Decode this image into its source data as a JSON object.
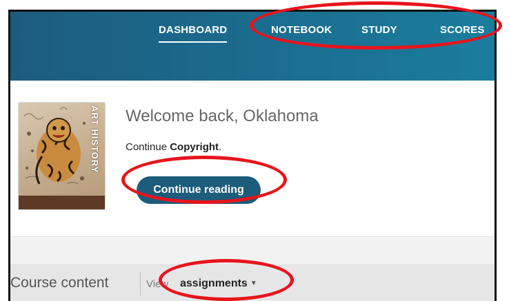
{
  "nav": {
    "items": [
      {
        "label": "DASHBOARD",
        "active": true
      },
      {
        "label": "NOTEBOOK",
        "active": false
      },
      {
        "label": "STUDY",
        "active": false
      },
      {
        "label": "SCORES",
        "active": false
      }
    ]
  },
  "book": {
    "cover_title": "ART HISTORY"
  },
  "welcome": {
    "heading": "Welcome back, Oklahoma",
    "continue_prefix": "Continue ",
    "continue_chapter": "Copyright",
    "continue_suffix": ".",
    "button_label": "Continue reading"
  },
  "course": {
    "label": "Course content",
    "view_label": "View",
    "view_value": "assignments"
  },
  "colors": {
    "header_blue": "#1b6a8c",
    "button_blue": "#1d5c7b",
    "annotation_red": "#e8141c"
  }
}
